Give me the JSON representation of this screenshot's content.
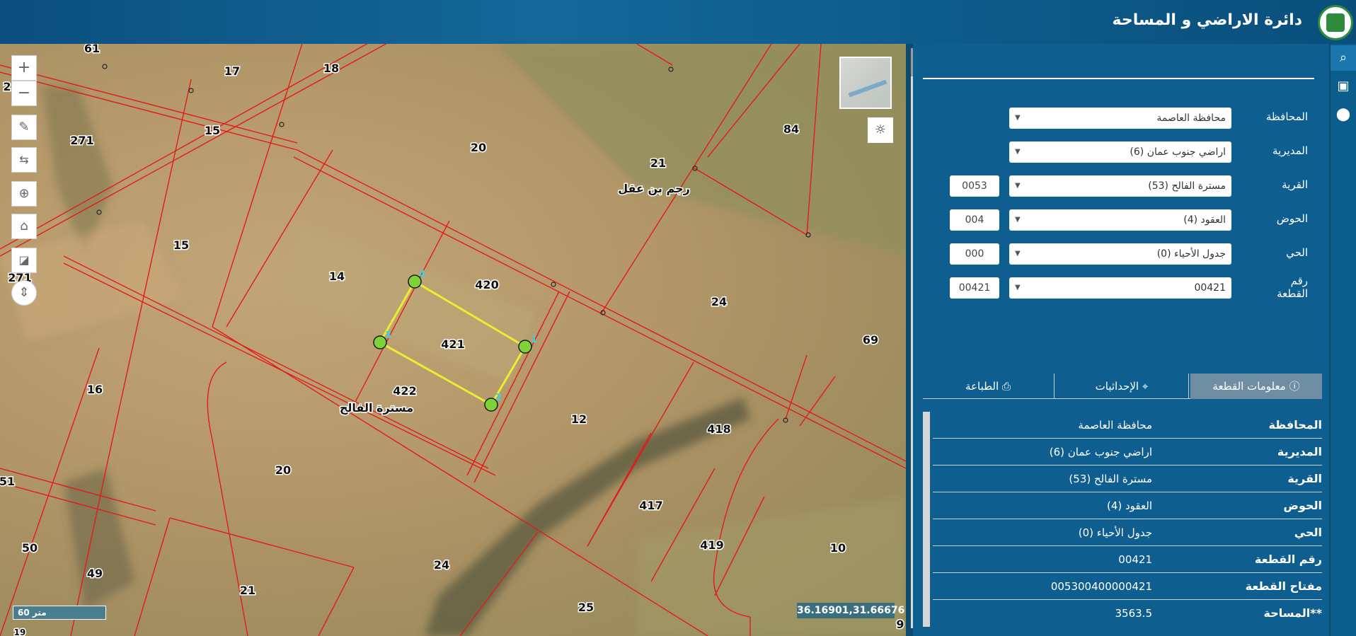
{
  "header": {
    "title": "دائرة الاراضي و المساحة",
    "logo_icon": "dls-logo-icon"
  },
  "map": {
    "parcel_labels": [
      "61",
      "17",
      "18",
      "15",
      "271",
      "20",
      "84",
      "21",
      "15",
      "14",
      "420",
      "421",
      "24",
      "69",
      "16",
      "422",
      "12",
      "418",
      "20",
      "417",
      "419",
      "10",
      "51",
      "50",
      "49",
      "24",
      "21",
      "25",
      "9",
      "271",
      "2",
      "19"
    ],
    "place_names": [
      "رجم بن عقل",
      "مسترة الفالح"
    ],
    "vertex_labels": [
      "1",
      "2",
      "3",
      "4"
    ],
    "scale_label": "60 متر",
    "coordinates": "36.16901,31.66676",
    "controls": [
      "zoom-in-icon",
      "zoom-out-icon",
      "draw-icon",
      "measure-icon",
      "locate-icon",
      "home-icon",
      "chart-icon",
      "compass-icon"
    ]
  },
  "rail": {
    "icons": [
      "search-icon",
      "wallet-icon",
      "location-pin-icon"
    ]
  },
  "panel": {
    "form": [
      {
        "label": "المحافظة",
        "value": "محافظة العاصمة",
        "code": ""
      },
      {
        "label": "المديرية",
        "value": "اراضي جنوب عمان (6)",
        "code": ""
      },
      {
        "label": "القرية",
        "value": "مسترة الفالح (53)",
        "code": "0053"
      },
      {
        "label": "الحوض",
        "value": "العقود (4)",
        "code": "004"
      },
      {
        "label": "الحي",
        "value": "جدول الأحياء (0)",
        "code": "000"
      },
      {
        "label": "رقم القطعة",
        "value": "00421",
        "code": "00421"
      }
    ],
    "tabs": [
      {
        "label": "معلومات القطعة",
        "icon": "info-icon"
      },
      {
        "label": "الإحداثيات",
        "icon": "coordinates-icon"
      },
      {
        "label": "الطباعة",
        "icon": "print-icon"
      }
    ],
    "info": [
      {
        "key": "المحافظة",
        "value": "محافظة العاصمة"
      },
      {
        "key": "المديرية",
        "value": "اراضي جنوب عمان (6)"
      },
      {
        "key": "القرية",
        "value": "مسترة الفالح (53)"
      },
      {
        "key": "الحوض",
        "value": "العقود (4)"
      },
      {
        "key": "الحي",
        "value": "جدول الأحياء (0)"
      },
      {
        "key": "رقم القطعة",
        "value": "00421"
      },
      {
        "key": "مفتاح القطعة",
        "value": "005300400000421"
      },
      {
        "key": "**المساحة",
        "value": "3563.5"
      }
    ]
  }
}
